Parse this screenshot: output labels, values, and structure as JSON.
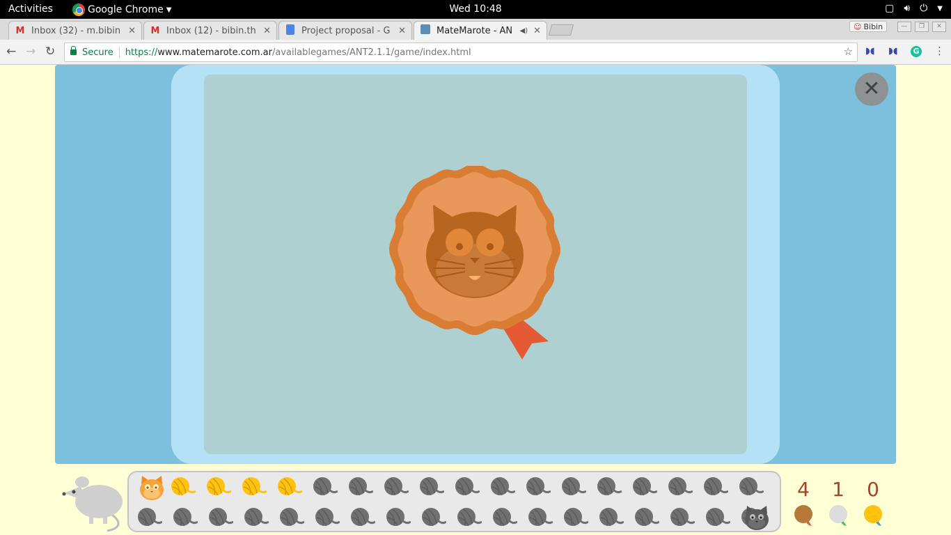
{
  "system_bar": {
    "activities": "Activities",
    "app_name": "Google Chrome",
    "clock": "Wed 10:48"
  },
  "tabs": [
    {
      "label": "Inbox (32) - m.bibin",
      "icon": "gmail-icon",
      "active": false
    },
    {
      "label": "Inbox (12) - bibin.th",
      "icon": "gmail-icon",
      "active": false
    },
    {
      "label": "Project proposal - G",
      "icon": "docs-icon",
      "active": false
    },
    {
      "label": "MateMarote - AN",
      "icon": "matemarote-icon",
      "active": true
    }
  ],
  "profile": {
    "name": "Bibin"
  },
  "address_bar": {
    "secure_label": "Secure",
    "url_scheme": "https://",
    "url_host": "www.matemarote.com.ar",
    "url_path": "/availablegames/ANT2.1.1/game/index.html"
  },
  "game": {
    "medal_type": "bronze",
    "progress": {
      "total_steps": 35,
      "completed_steps": 4,
      "current_position_icon": "orange-cat-icon",
      "goal_icon": "dark-cat-icon"
    },
    "scores": {
      "bronze": "4",
      "silver": "1",
      "gold": "0"
    }
  },
  "colors": {
    "frame": "#7cc0de",
    "card": "#b5e1f6",
    "board": "#afd0d0",
    "medal": "#e9975a",
    "ribbon": "#e45a35",
    "yarn_done": "#ffc20e",
    "yarn_todo": "#707070",
    "score_text": "#a8432a"
  }
}
